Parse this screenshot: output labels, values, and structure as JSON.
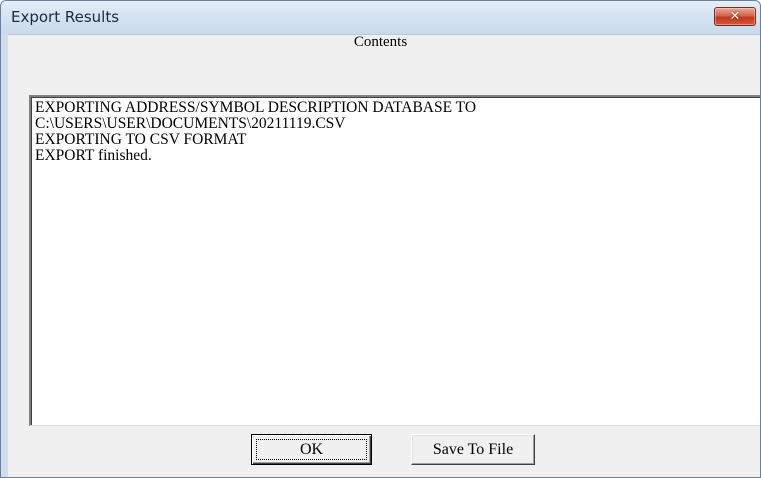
{
  "window": {
    "title": "Export Results",
    "close_icon": "close-icon"
  },
  "contents": {
    "label": "Contents",
    "lines": [
      "EXPORTING ADDRESS/SYMBOL DESCRIPTION DATABASE TO",
      "C:\\USERS\\USER\\DOCUMENTS\\20211119.CSV",
      "EXPORTING TO CSV FORMAT",
      "EXPORT finished."
    ]
  },
  "buttons": {
    "ok_label": "OK",
    "save_label": "Save To File"
  },
  "colors": {
    "titlebar": "#d6e3f2",
    "close_button": "#c0391c",
    "dialog_face": "#f0f0f0"
  }
}
